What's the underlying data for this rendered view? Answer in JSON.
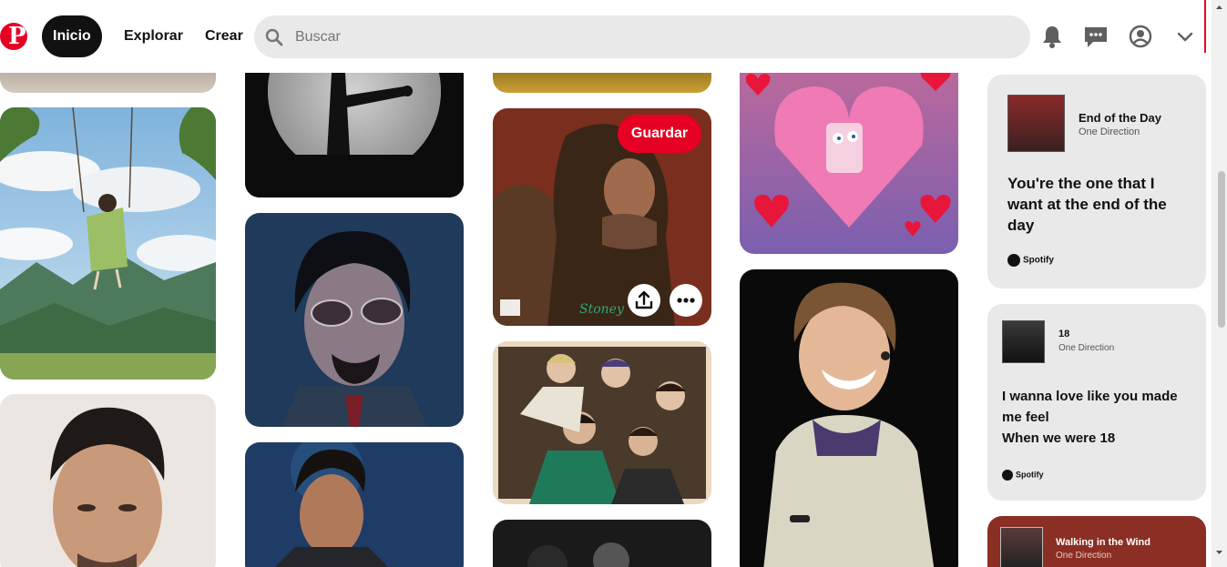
{
  "header": {
    "logo_letter": "P",
    "nav": {
      "home": "Inicio",
      "explore": "Explorar",
      "create": "Crear"
    },
    "search": {
      "placeholder": "Buscar"
    },
    "icons": [
      "notifications-icon",
      "messages-icon",
      "account-icon",
      "chevron-down-icon"
    ]
  },
  "pins": {
    "save_label": "Guardar",
    "image_label_small": "Stoney"
  },
  "spotify_cards": [
    {
      "song": "End of the Day",
      "artist": "One Direction",
      "lyric": "You're the one that I want at the end of the day",
      "brand": "Spotify"
    },
    {
      "song": "18",
      "artist": "One Direction",
      "lyric": "I wanna love like you made me feel\nWhen we were 18",
      "brand": "Spotify"
    },
    {
      "song": "Walking in the Wind",
      "artist": "One Direction"
    }
  ],
  "colors": {
    "brand_red": "#e60023",
    "search_bg": "#e9e9e9",
    "active_nav_bg": "#111111",
    "card_bg": "#e9e9e9",
    "card_dark_bg": "#8b2e23"
  }
}
